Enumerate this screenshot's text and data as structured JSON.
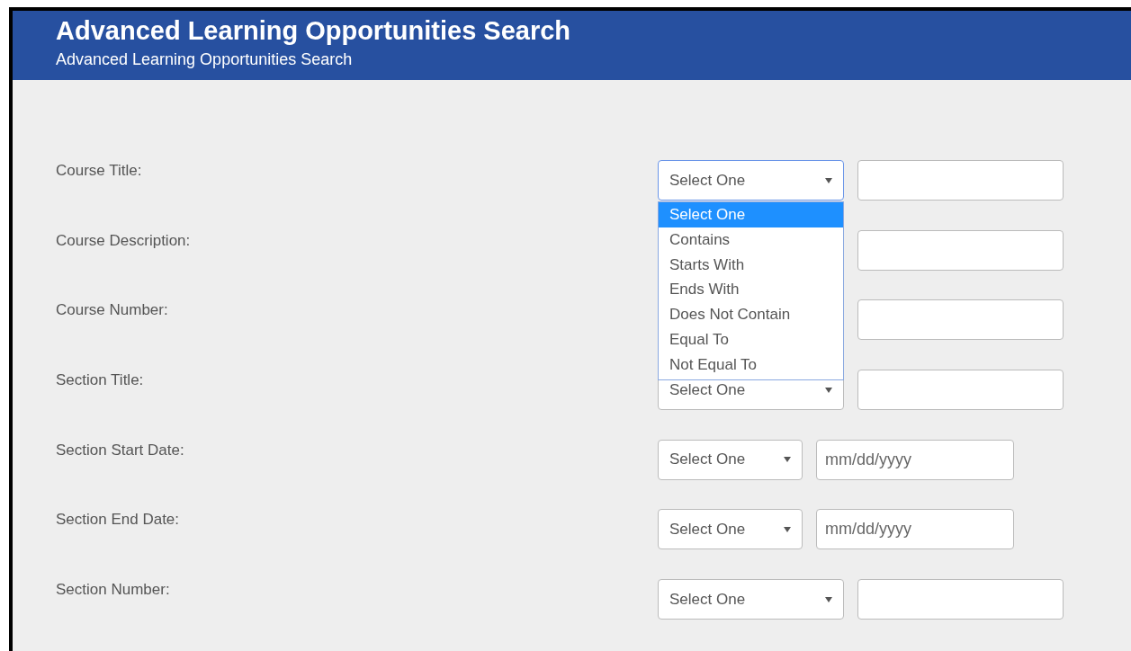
{
  "header": {
    "title": "Advanced Learning Opportunities Search",
    "subtitle": "Advanced Learning Opportunities Search"
  },
  "rows": [
    {
      "label": "Course Title:",
      "kind": "text",
      "operator": {
        "value": "Select One",
        "focused": true,
        "options": [
          {
            "label": "Select One",
            "selected": true
          },
          {
            "label": "Contains",
            "selected": false
          },
          {
            "label": "Starts With",
            "selected": false
          },
          {
            "label": "Ends With",
            "selected": false
          },
          {
            "label": "Does Not Contain",
            "selected": false
          },
          {
            "label": "Equal To",
            "selected": false
          },
          {
            "label": "Not Equal To",
            "selected": false
          }
        ]
      }
    },
    {
      "label": "Course Description:",
      "kind": "text"
    },
    {
      "label": "Course Number:",
      "kind": "text"
    },
    {
      "label": "Section Title:",
      "kind": "text",
      "operator": {
        "value": "Select One",
        "focused": false
      }
    },
    {
      "label": "Section Start Date:",
      "kind": "date",
      "placeholder": "mm/dd/yyyy",
      "operator": {
        "value": "Select One",
        "focused": false
      }
    },
    {
      "label": "Section End Date:",
      "kind": "date",
      "placeholder": "mm/dd/yyyy",
      "operator": {
        "value": "Select One",
        "focused": false
      }
    },
    {
      "label": "Section Number:",
      "kind": "text",
      "operator": {
        "value": "Select One",
        "focused": false
      }
    }
  ]
}
